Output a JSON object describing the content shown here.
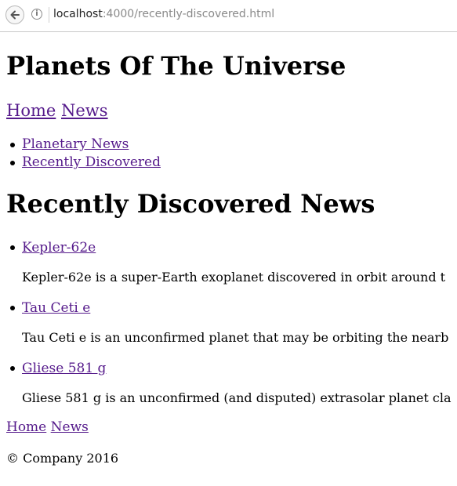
{
  "browser": {
    "url_host": "localhost",
    "url_rest": ":4000/recently-discovered.html"
  },
  "header": {
    "title": "Planets Of The Universe"
  },
  "top_nav": [
    {
      "label": "Home"
    },
    {
      "label": "News"
    }
  ],
  "sub_nav": [
    {
      "label": "Planetary News"
    },
    {
      "label": "Recently Discovered"
    }
  ],
  "main": {
    "heading": "Recently Discovered News",
    "items": [
      {
        "title": "Kepler-62e",
        "description": "Kepler-62e is a super-Earth exoplanet discovered in orbit around t"
      },
      {
        "title": "Tau Ceti e",
        "description": "Tau Ceti e is an unconfirmed planet that may be orbiting the nearb"
      },
      {
        "title": "Gliese 581 g",
        "description": "Gliese 581 g is an unconfirmed (and disputed) extrasolar planet cla"
      }
    ]
  },
  "footer": {
    "nav": [
      {
        "label": "Home"
      },
      {
        "label": "News"
      }
    ],
    "copyright": "© Company 2016"
  },
  "colors": {
    "link": "#551a8b",
    "text": "#000000"
  }
}
